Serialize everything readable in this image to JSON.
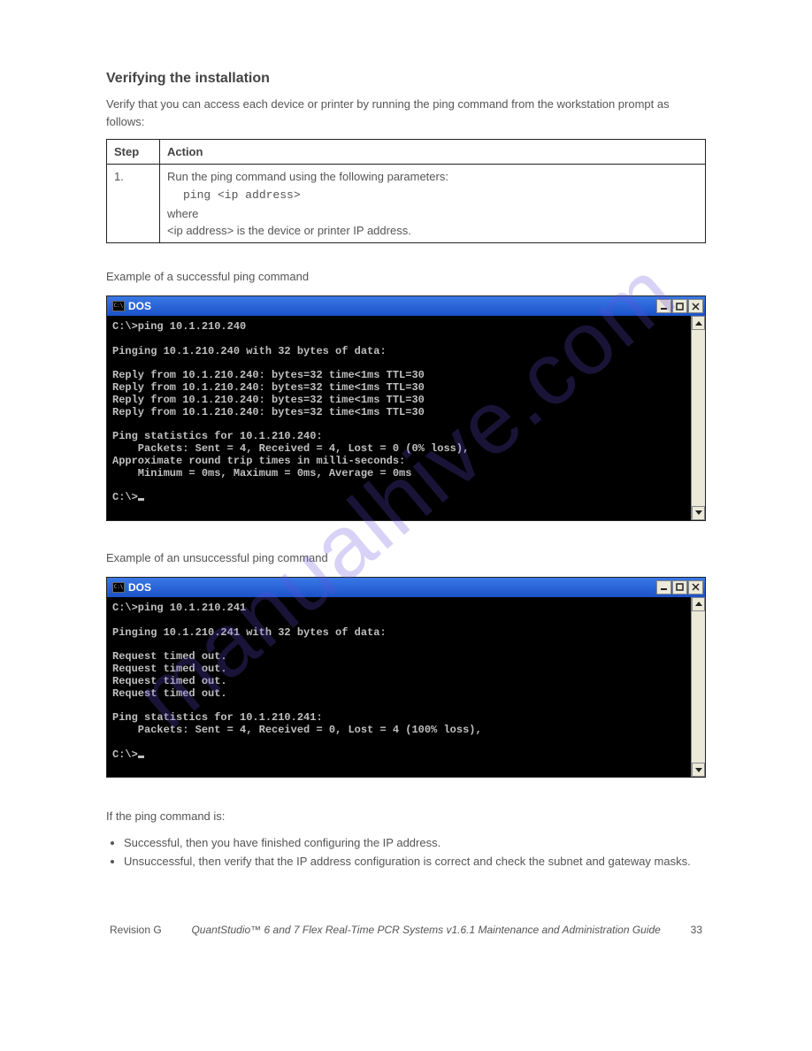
{
  "section_title": "Verifying the installation",
  "intro_text": "Verify that you can access each device or printer by running the ping command from the workstation prompt as follows:",
  "table": {
    "header": {
      "step": "Step",
      "action": "Action"
    },
    "row": {
      "step": "1.",
      "action_line1": "Run the ping command using the following parameters:",
      "action_cmd": "ping <ip address>",
      "action_where": "where",
      "action_line2": "<ip address> is the device or printer IP address."
    }
  },
  "watermark": "manualhive.com",
  "dos_title": "DOS",
  "success_caption": "Example of a successful ping command",
  "fail_caption": "Example of an unsuccessful ping command",
  "terminal_success": [
    "C:\\>ping 10.1.210.240",
    "",
    "Pinging 10.1.210.240 with 32 bytes of data:",
    "",
    "Reply from 10.1.210.240: bytes=32 time<1ms TTL=30",
    "Reply from 10.1.210.240: bytes=32 time<1ms TTL=30",
    "Reply from 10.1.210.240: bytes=32 time<1ms TTL=30",
    "Reply from 10.1.210.240: bytes=32 time<1ms TTL=30",
    "",
    "Ping statistics for 10.1.210.240:",
    "    Packets: Sent = 4, Received = 4, Lost = 0 (0% loss),",
    "Approximate round trip times in milli-seconds:",
    "    Minimum = 0ms, Maximum = 0ms, Average = 0ms",
    "",
    "C:\\>"
  ],
  "terminal_fail": [
    "C:\\>ping 10.1.210.241",
    "",
    "Pinging 10.1.210.241 with 32 bytes of data:",
    "",
    "Request timed out.",
    "Request timed out.",
    "Request timed out.",
    "Request timed out.",
    "",
    "Ping statistics for 10.1.210.241:",
    "    Packets: Sent = 4, Received = 0, Lost = 4 (100% loss),",
    "",
    "C:\\>"
  ],
  "notes_intro": "If the ping command is:",
  "bullet_success": "Successful, then you have finished configuring the IP address.",
  "bullet_fail": "Unsuccessful, then verify that the IP address configuration is correct and check the subnet and gateway masks.",
  "footer_left": "Revision G",
  "footer_center": "QuantStudio™ 6 and 7 Flex Real-Time PCR Systems v1.6.1 Maintenance and Administration Guide",
  "footer_right": "33"
}
